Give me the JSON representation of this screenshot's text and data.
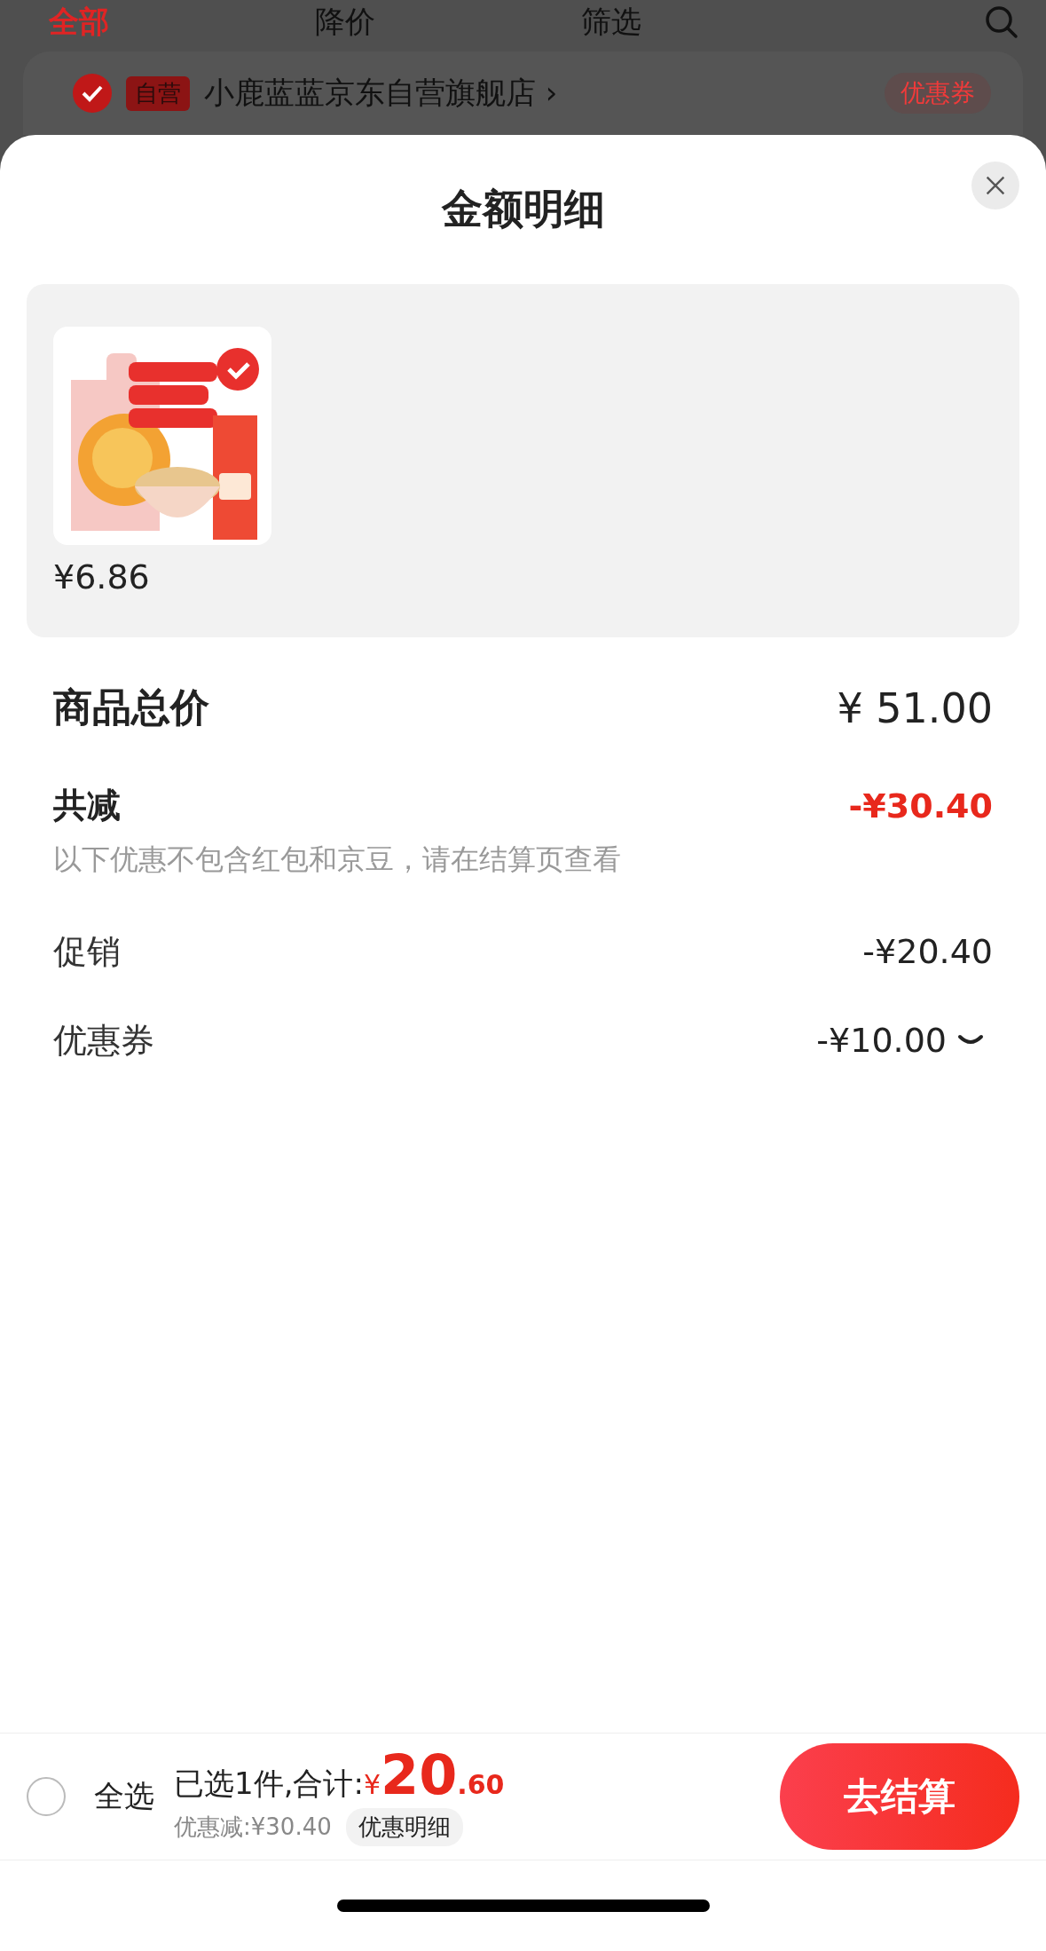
{
  "background": {
    "tabs": [
      {
        "label": "全部",
        "selected": true
      },
      {
        "label": "降价",
        "selected": false
      },
      {
        "label": "筛选",
        "selected": false
      }
    ],
    "store": {
      "badge": "自营",
      "name": "小鹿蓝蓝京东自营旗舰店 ›",
      "coupon": "优惠券"
    }
  },
  "sheet": {
    "title": "金额明细",
    "product": {
      "kind": "picture",
      "price": "¥6.86"
    },
    "rows": [
      {
        "kind": "total",
        "label": "商品总价",
        "value": "¥ 51.00"
      },
      {
        "kind": "discount",
        "label": "共减",
        "value": "-¥30.40",
        "note": "以下优惠不包含红包和京豆，请在结算页查看"
      },
      {
        "kind": "item",
        "label": "促销",
        "value": "-¥20.40",
        "expandable": false
      },
      {
        "kind": "item",
        "label": "优惠券",
        "value": "-¥10.00",
        "expandable": true
      }
    ]
  },
  "footer": {
    "select_all": {
      "label": "全选",
      "checked": false
    },
    "summary": "已选1件,合计:",
    "currency": "¥",
    "total_int": "20",
    "total_dec": ".60",
    "saved": "优惠减:¥30.40",
    "detail_button": "优惠明细",
    "checkout": "去结算"
  }
}
